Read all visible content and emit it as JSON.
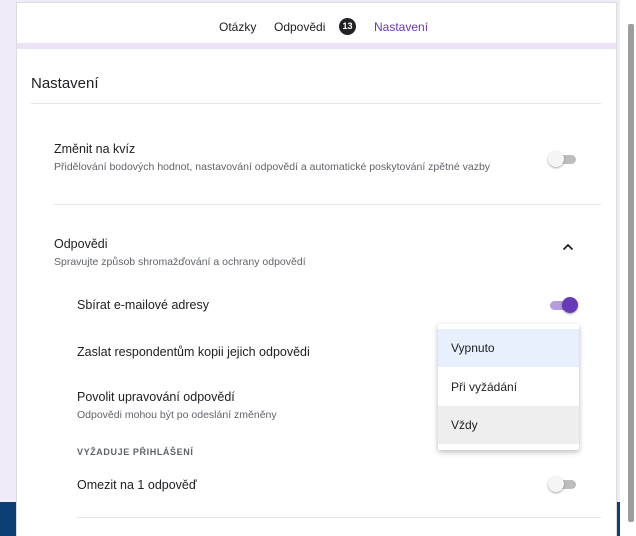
{
  "tabs": {
    "questions": "Otázky",
    "responses": "Odpovědi",
    "responses_count": "13",
    "settings": "Nastavení"
  },
  "page_title": "Nastavení",
  "quiz": {
    "title": "Změnit na kvíz",
    "description": "Přidělování bodových hodnot, nastavování odpovědí a automatické poskytování zpětné vazby",
    "toggle_on": false
  },
  "responses": {
    "title": "Odpovědi",
    "description": "Spravujte způsob shromažďování a ochrany odpovědí",
    "collect_emails": {
      "label": "Sbírat e-mailové adresy",
      "toggle_on": true
    },
    "send_copy": {
      "label": "Zaslat respondentům kopii jejich odpovědi"
    },
    "allow_edit": {
      "label": "Povolit upravování odpovědí",
      "description": "Odpovědi mohou být po odeslání změněny"
    },
    "requires_signin_caption": "VYŽADUJE PŘIHLÁŠENÍ",
    "limit_one": {
      "label": "Omezit na 1 odpověď",
      "toggle_on": false
    }
  },
  "dropdown_options": [
    "Vypnuto",
    "Při vyžádání",
    "Vždy"
  ],
  "colors": {
    "accent": "#673ab7",
    "accent_light": "#b39ddb",
    "header_band": "#0c3f74"
  }
}
